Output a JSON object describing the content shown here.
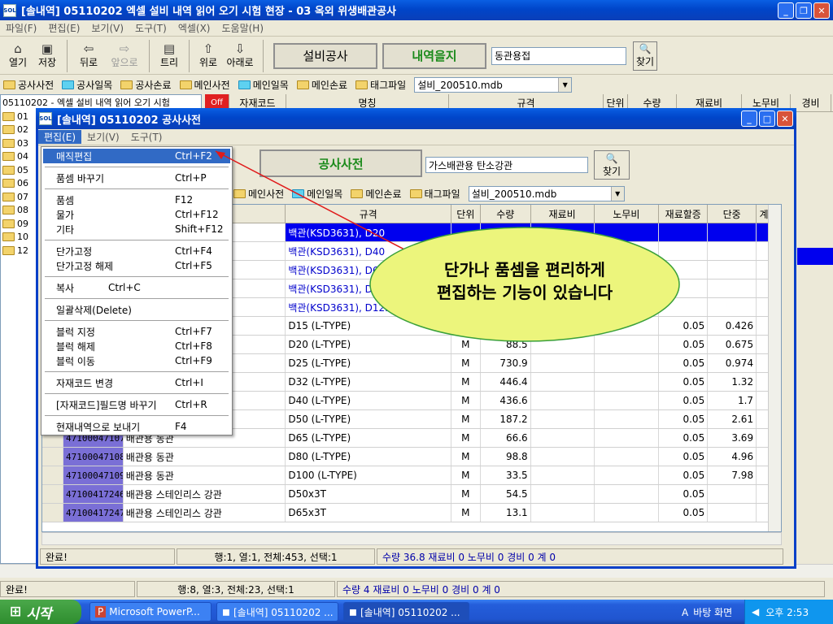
{
  "main": {
    "title": "[솔내역] 05110202 엑셀 설비 내역 읽어 오기 시험 현장 - 03 옥외 위생배관공사",
    "menu": [
      "파일(F)",
      "편집(E)",
      "보기(V)",
      "도구(T)",
      "엑셀(X)",
      "도움말(H)"
    ],
    "toolbar": {
      "open": "열기",
      "save": "저장",
      "back": "뒤로",
      "forward": "앞으로",
      "tree": "트리",
      "up": "위로",
      "down": "아래로",
      "btn1": "설비공사",
      "btn2": "내역을지",
      "search_value": "동관용접",
      "find": "찾기"
    },
    "folders": [
      "공사사전",
      "공사일목",
      "공사손료",
      "메인사전",
      "메인일목",
      "메인손료",
      "태그파일"
    ],
    "db": "설비_200510.mdb",
    "tree_header": "05110202 - 엑셀 설비 내역 읽어 오기 시험",
    "tree_items": [
      "01",
      "02",
      "03",
      "04",
      "05",
      "06",
      "07",
      "08",
      "09",
      "10",
      "12"
    ],
    "cols": [
      "자재코드",
      "명칭",
      "규격",
      "단위",
      "수량",
      "재료비",
      "노무비",
      "경비"
    ],
    "tag": "Off",
    "status": {
      "done": "완료!",
      "pos": "행:8, 열:3, 전체:23, 선택:1",
      "sum": "수량 4   재료비 0   노무비 0   경비 0   계 0"
    }
  },
  "dict": {
    "title": "[솔내역] 05110202 공사사전",
    "menu": [
      "편집(E)",
      "보기(V)",
      "도구(T)"
    ],
    "btn": "공사사전",
    "search_value": "가스배관용 탄소강관",
    "find": "찾기",
    "folders": [
      "메인사전",
      "메인일목",
      "메인손료",
      "태그파일"
    ],
    "db": "설비_200510.mdb",
    "cols": [
      "규격",
      "단위",
      "수량",
      "재료비",
      "노무비",
      "재료할증",
      "단중",
      "계산"
    ],
    "rows": [
      {
        "code": "",
        "name": "",
        "spec": "백관(KSD3631), D20",
        "unit": "",
        "qty": "",
        "rate": "",
        "weight": "",
        "sel": true
      },
      {
        "code": "",
        "name": "",
        "spec": "백관(KSD3631), D40",
        "unit": "",
        "qty": "",
        "rate": "",
        "weight": ""
      },
      {
        "code": "",
        "name": "",
        "spec": "백관(KSD3631), D65",
        "unit": "",
        "qty": "",
        "rate": "",
        "weight": ""
      },
      {
        "code": "",
        "name": "",
        "spec": "백관(KSD3631), D100",
        "unit": "",
        "qty": "",
        "rate": "",
        "weight": ""
      },
      {
        "code": "",
        "name": "",
        "spec": "백관(KSD3631), D125",
        "unit": "",
        "qty": "",
        "rate": "",
        "weight": ""
      },
      {
        "code": "",
        "name": "",
        "spec": "D15   (L-TYPE)",
        "unit": "M",
        "qty": "",
        "rate": "0.05",
        "weight": "0.426"
      },
      {
        "code": "",
        "name": "",
        "spec": "D20   (L-TYPE)",
        "unit": "M",
        "qty": "88.5",
        "rate": "0.05",
        "weight": "0.675"
      },
      {
        "code": "",
        "name": "",
        "spec": "D25   (L-TYPE)",
        "unit": "M",
        "qty": "730.9",
        "rate": "0.05",
        "weight": "0.974"
      },
      {
        "code": "",
        "name": "",
        "spec": "D32   (L-TYPE)",
        "unit": "M",
        "qty": "446.4",
        "rate": "0.05",
        "weight": "1.32"
      },
      {
        "code": "",
        "name": "",
        "spec": "D40   (L-TYPE)",
        "unit": "M",
        "qty": "436.6",
        "rate": "0.05",
        "weight": "1.7"
      },
      {
        "code": "",
        "name": "",
        "spec": "D50   (L-TYPE)",
        "unit": "M",
        "qty": "187.2",
        "rate": "0.05",
        "weight": "2.61"
      },
      {
        "code": "47100047107",
        "name": "배관용 동관",
        "spec": "D65   (L-TYPE)",
        "unit": "M",
        "qty": "66.6",
        "rate": "0.05",
        "weight": "3.69"
      },
      {
        "code": "47100047108",
        "name": "배관용 동관",
        "spec": "D80   (L-TYPE)",
        "unit": "M",
        "qty": "98.8",
        "rate": "0.05",
        "weight": "4.96"
      },
      {
        "code": "47100047109",
        "name": "배관용 동관",
        "spec": "D100  (L-TYPE)",
        "unit": "M",
        "qty": "33.5",
        "rate": "0.05",
        "weight": "7.98"
      },
      {
        "code": "47100417246",
        "name": "배관용 스테인리스 강관",
        "spec": "D50x3T",
        "unit": "M",
        "qty": "54.5",
        "rate": "0.05",
        "weight": ""
      },
      {
        "code": "47100417247",
        "name": "배관용 스테인리스 강관",
        "spec": "D65x3T",
        "unit": "M",
        "qty": "13.1",
        "rate": "0.05",
        "weight": ""
      }
    ],
    "status": {
      "done": "완료!",
      "pos": "행:1, 열:1, 전체:453, 선택:1",
      "sum": "수량 36.8   재료비 0   노무비 0   경비 0   계 0"
    }
  },
  "context_menu": [
    {
      "label": "매직편집",
      "sc": "Ctrl+F2",
      "hi": true
    },
    {
      "sep": true
    },
    {
      "label": "품셈 바꾸기",
      "sc": "Ctrl+P"
    },
    {
      "sep": true
    },
    {
      "label": "품셈",
      "sc": "F12"
    },
    {
      "label": "물가",
      "sc": "Ctrl+F12"
    },
    {
      "label": "기타",
      "sc": "Shift+F12"
    },
    {
      "sep": true
    },
    {
      "label": "단가고정",
      "sc": "Ctrl+F4"
    },
    {
      "label": "단가고정 해제",
      "sc": "Ctrl+F5"
    },
    {
      "sep": true
    },
    {
      "label": "복사",
      "sc": "Ctrl+C",
      "near": true
    },
    {
      "sep": true
    },
    {
      "label": "일괄삭제(Delete)",
      "sc": ""
    },
    {
      "sep": true
    },
    {
      "label": "블럭 지정",
      "sc": "Ctrl+F7"
    },
    {
      "label": "블럭 해제",
      "sc": "Ctrl+F8"
    },
    {
      "label": "블럭 이동",
      "sc": "Ctrl+F9"
    },
    {
      "sep": true
    },
    {
      "label": "자재코드 변경",
      "sc": "Ctrl+I"
    },
    {
      "sep": true
    },
    {
      "label": "[자재코드]필드명 바꾸기",
      "sc": "Ctrl+R"
    },
    {
      "sep": true
    },
    {
      "label": "현재내역으로 보내기",
      "sc": "F4"
    }
  ],
  "callout": {
    "line1": "단가나 품셈을 편리하게",
    "line2": "편집하는 기능이 있습니다"
  },
  "taskbar": {
    "start": "시작",
    "items": [
      "Microsoft PowerP...",
      "[솔내역] 05110202 ...",
      "[솔내역] 05110202 ..."
    ],
    "desktop": "바탕 화면",
    "clock": "오후 2:53"
  },
  "colors": {
    "title": "#0a4fd8",
    "selection": "#0000ee",
    "code_bg": "#7a6fd6",
    "callout": "#ecf57c"
  }
}
